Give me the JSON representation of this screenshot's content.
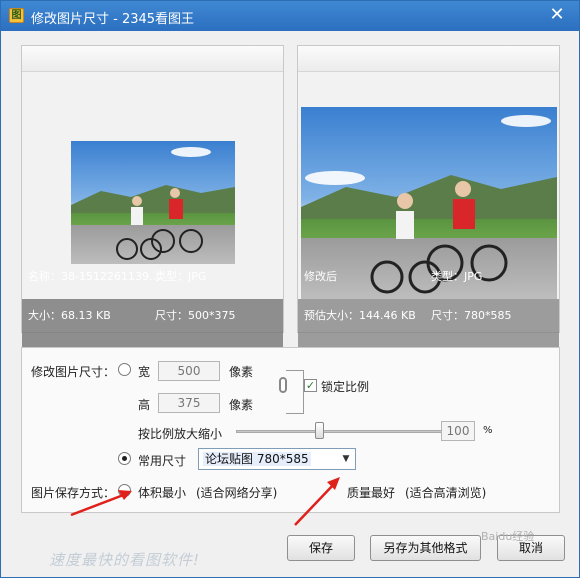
{
  "window": {
    "title": "修改图片尺寸 - 2345看图王",
    "app_icon_glyph": "图",
    "close_glyph": "✕"
  },
  "original": {
    "name_label": "名称：38-1512261139...",
    "type_label": "类型：JPG",
    "size_label": "大小：68.13 KB",
    "dimension_label": "尺寸：500*375"
  },
  "preview": {
    "status_label": "修改后",
    "type_label": "类型：JPG",
    "size_label": "预估大小：144.46 KB",
    "dimension_label": "尺寸：780*585"
  },
  "resize": {
    "section_label": "修改图片尺寸：",
    "width_label": "宽",
    "width_value": "500",
    "height_label": "高",
    "height_value": "375",
    "unit_label": "像素",
    "lock_ratio_label": "锁定比例",
    "lock_ratio_checked": true,
    "scale_label": "按比例放大缩小",
    "scale_value": "100",
    "scale_unit": "%",
    "scale_level_percent": 100,
    "common_size_label": "常用尺寸",
    "common_size_selected": "论坛贴图 780*585"
  },
  "save_mode": {
    "section_label": "图片保存方式：",
    "option_small_label": "体积最小",
    "option_small_hint": "(适合网络分享)",
    "option_quality_label": "质量最好",
    "option_quality_hint": "(适合高清浏览)"
  },
  "buttons": {
    "save": "保存",
    "save_as": "另存为其他格式",
    "cancel": "取消"
  },
  "footer": {
    "tagline": "速度最快的看图软件!",
    "watermark": "Baidu经验"
  },
  "colors": {
    "titlebar": "#2c6fc0",
    "annotation_arrow": "#e0201b"
  }
}
